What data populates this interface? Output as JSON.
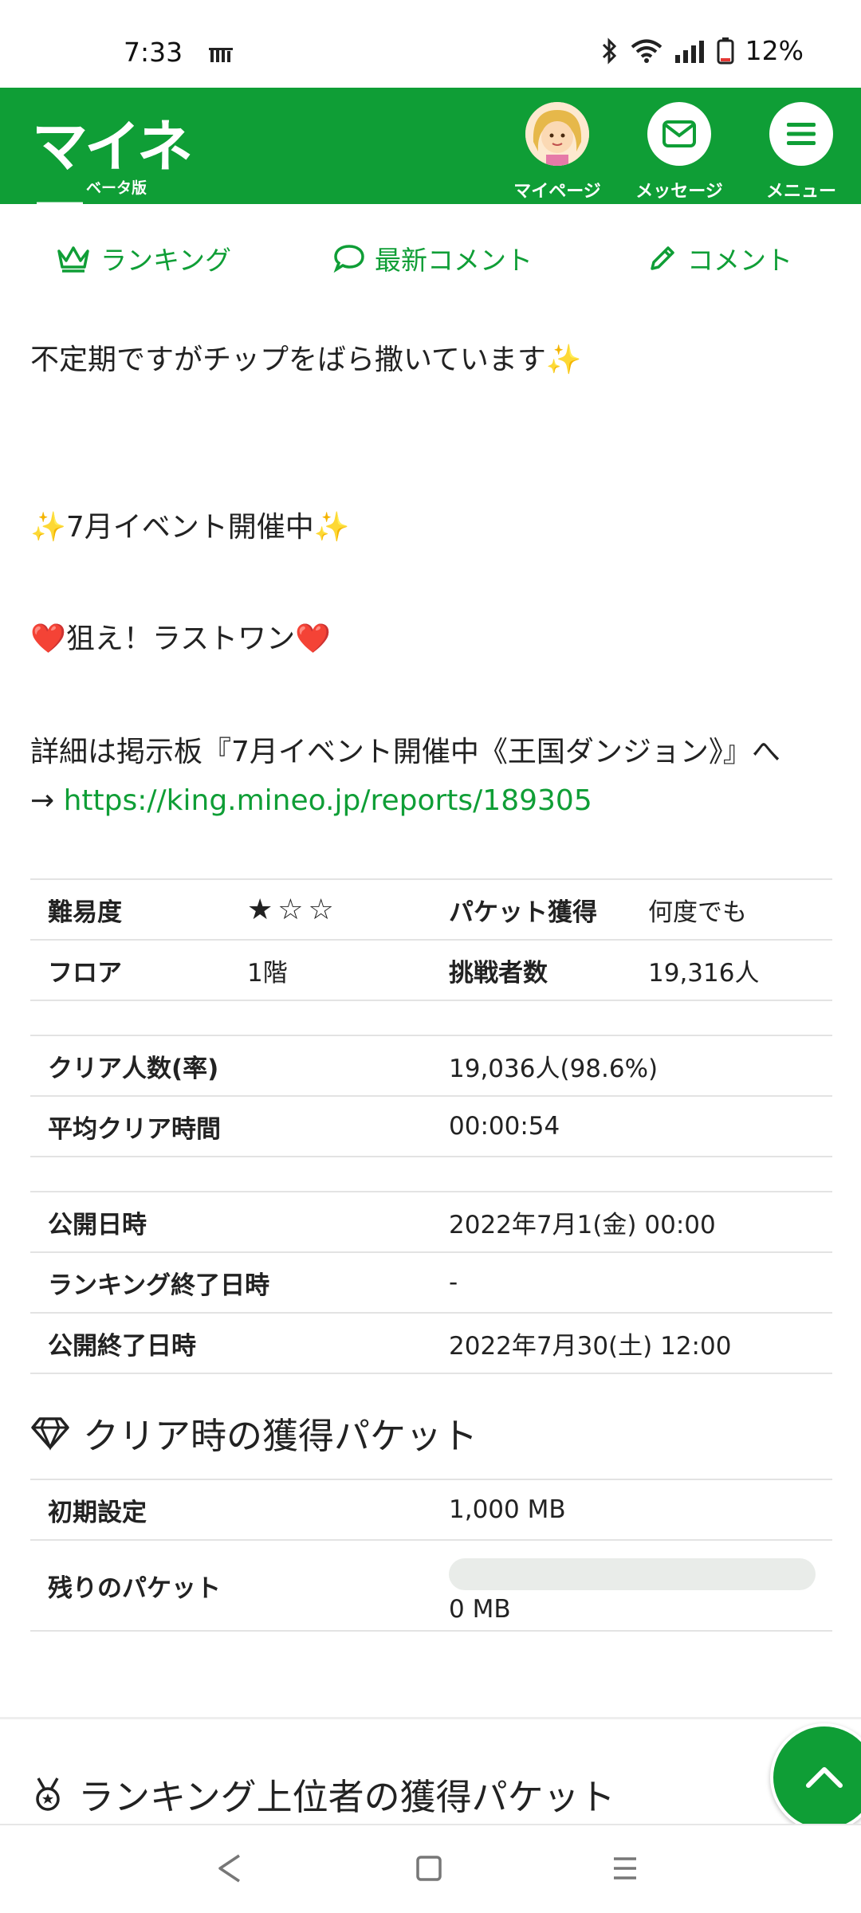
{
  "status_bar": {
    "time": "7:33",
    "battery": "12%"
  },
  "header": {
    "logo_text": "マイネ王",
    "logo_sub": "ベータ版",
    "mypage_label": "マイページ",
    "message_label": "メッセージ",
    "menu_label": "メニュー"
  },
  "tabs": [
    {
      "label": "ランキング"
    },
    {
      "label": "最新コメント"
    },
    {
      "label": "コメント"
    }
  ],
  "body": {
    "line1": "不定期ですがチップをばら撒いています✨",
    "line2": "✨7月イベント開催中✨",
    "line3": "❤️狙え！ラストワン❤️",
    "line4": "詳細は掲示板『7月イベント開催中《王国ダンジョン》』へ",
    "arrow": "→ ",
    "link": "https://king.mineo.jp/reports/189305"
  },
  "info_table": {
    "difficulty_label": "難易度",
    "difficulty_stars": "★☆☆",
    "packet_label": "パケット獲得",
    "packet_value": "何度でも",
    "floor_label": "フロア",
    "floor_value": "1階",
    "challengers_label": "挑戦者数",
    "challengers_value": "19,316人"
  },
  "clear_table": {
    "clear_count_label": "クリア人数(率)",
    "clear_count_value": "19,036人(98.6%)",
    "avg_time_label": "平均クリア時間",
    "avg_time_value": "00:00:54"
  },
  "date_table": {
    "publish_label": "公開日時",
    "publish_value": "2022年7月1(金) 00:00",
    "ranking_end_label": "ランキング終了日時",
    "ranking_end_value": "-",
    "publish_end_label": "公開終了日時",
    "publish_end_value": "2022年7月30(土) 12:00"
  },
  "packet_section": {
    "title": "クリア時の獲得パケット",
    "initial_label": "初期設定",
    "initial_value": "1,000 MB",
    "remaining_label": "残りのパケット",
    "remaining_value": "0 MB",
    "remaining_fraction": 0
  },
  "ranking_section": {
    "title": "ランキング上位者の獲得パケット"
  },
  "colors": {
    "brand_green": "#0f9e36"
  }
}
